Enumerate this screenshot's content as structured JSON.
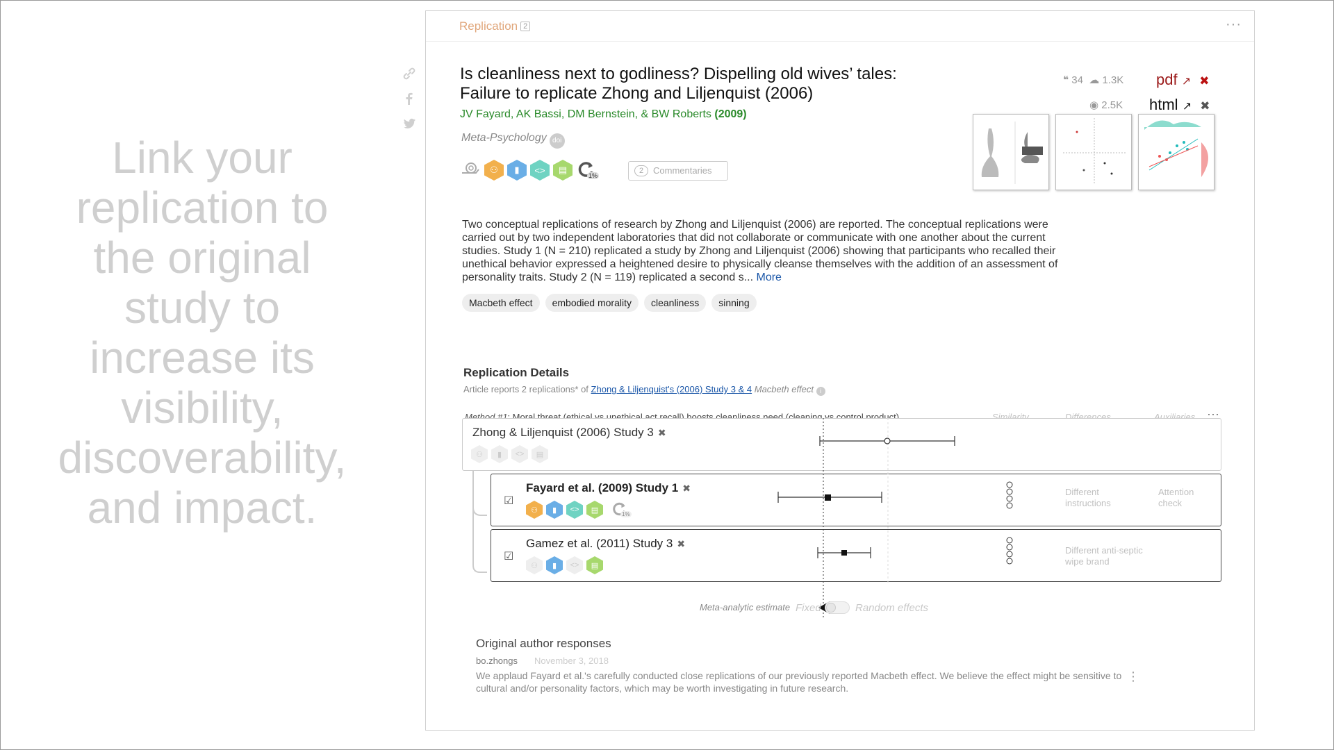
{
  "tagline": "Link your replication to the original study to increase its visibility, discoverability, and impact.",
  "card": {
    "breadcrumb": "Replication",
    "breadcrumb_count": "2",
    "more": "···"
  },
  "share_icons": [
    "link-icon",
    "facebook-icon",
    "twitter-icon"
  ],
  "article": {
    "title": "Is cleanliness next to godliness? Dispelling old wives’ tales: Failure to replicate Zhong and Liljenquist (2006)",
    "authors": "JV Fayard, AK Bassi, DM Bernstein, & BW Roberts",
    "year": "(2009)",
    "journal": "Meta-Psychology",
    "doi_label": "doi",
    "commentaries_count": "2",
    "commentaries_label": "Commentaries",
    "replication_pct": "1%",
    "citations": "34",
    "downloads": "1.3K",
    "views": "2.5K",
    "pdf_label": "pdf",
    "html_label": "html",
    "abstract": "Two conceptual replications of research by Zhong and Liljenquist (2006) are reported. The conceptual replications were carried out by two independent laboratories that did not collaborate or communicate with one another about the current studies. Study 1 (N = 210) replicated a study by Zhong and Liljenquist (2006) showing that participants who recalled their unethical behavior expressed a heightened desire to physically cleanse themselves with the addition of an assessment of personality traits. Study 2 (N = 119) replicated a second s...",
    "more_link": "More",
    "tags": [
      "Macbeth effect",
      "embodied morality",
      "cleanliness",
      "sinning"
    ]
  },
  "replication_details": {
    "title": "Replication Details",
    "subtitle_prefix": "Article reports 2 replications* of",
    "original_link": "Zhong & Liljenquist's (2006) Study 3 & 4",
    "effect": "Macbeth effect",
    "method_label": "Method #1",
    "method_text": ": Moral threat (ethical vs unethical act recall) boosts cleanliness need (cleaning vs control product)",
    "col_similarity": "Similarity",
    "col_differences": "Differences",
    "col_auxiliaries": "Auxiliaries",
    "col_more": "···",
    "original_study": "Zhong & Liljenquist (2006) Study 3",
    "studies": [
      {
        "name": "Fayard et al. (2009) Study 1",
        "difference": "Different instructions",
        "auxiliary": "Attention check",
        "pct": "1%"
      },
      {
        "name": "Gamez et al. (2011) Study 3",
        "difference": "Different anti-septic wipe brand",
        "auxiliary": ""
      }
    ],
    "meta_label": "Meta-analytic estimate",
    "toggle_left": "Fixed",
    "toggle_right": "Random effects"
  },
  "responses": {
    "title": "Original author responses",
    "user": "bo.zhongs",
    "date": "November 3, 2018",
    "text": "We applaud Fayard et al.'s carefully conducted close replications of our previously reported Macbeth effect. We believe the effect might be sensitive to cultural and/or personality factors, which may be worth investigating in future research.",
    "more": "⋮"
  },
  "colors": {
    "accent_orange": "#e0a67a",
    "author_green": "#2a8a2a",
    "link_blue": "#1a56a8",
    "pdf_red": "#9b1a1a",
    "badge_orange": "#f2b04c",
    "badge_blue": "#6aaee6",
    "badge_teal": "#6fd3c2",
    "badge_green": "#a7d86d"
  }
}
